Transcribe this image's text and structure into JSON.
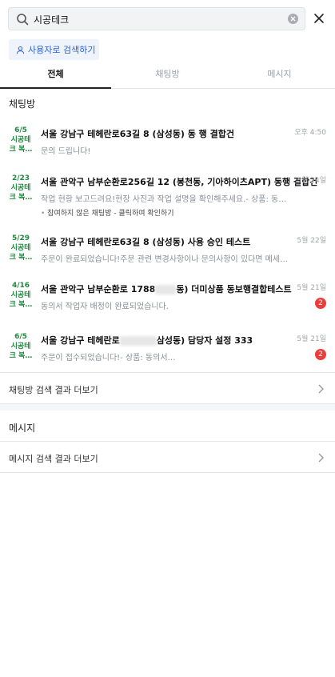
{
  "search": {
    "value": "시공테크"
  },
  "user_search_button": {
    "label": "사용자로 검색하기"
  },
  "tabs": [
    {
      "label": "전체",
      "active": true
    },
    {
      "label": "채팅방",
      "active": false
    },
    {
      "label": "메시지",
      "active": false
    }
  ],
  "chat_section": {
    "title": "채팅방",
    "items": [
      {
        "date": "6/5",
        "tag1": "시공테",
        "tag2": "크 복…",
        "title": "서울 강남구 테헤란로63길 8 (삼성동) 동 행 결합건",
        "sub": "문의 드립니다!",
        "time": "오후 4:50",
        "unread": null,
        "note": null
      },
      {
        "date": "2/23",
        "tag1": "시공테",
        "tag2": "크 복…",
        "title": "서울 관악구 남부순환로256길 12 (봉천동, 기아하이츠APT) 동행 결합건",
        "sub": "작업 현황 보고드려요!현장 사진과 작업 설명을 확인해주세요.- 상품: 동의서…",
        "time": "5월 24일",
        "unread": null,
        "note": "참여하지 않은 채팅방 - 클릭하여 확인하기"
      },
      {
        "date": "5/29",
        "tag1": "시공테",
        "tag2": "크 복…",
        "title": "서울 강남구 테헤란로63길 8 (삼성동) 사용 승인 테스트",
        "sub": "주문이 완료되었습니다!주문 관련 변경사항이나 문의사항이 있다면 메세지를 남겨주세…",
        "time": "5월 22일",
        "unread": null,
        "note": null
      },
      {
        "date": "4/16",
        "tag1": "시공테",
        "tag2": "크 복…",
        "title": "서울 관악구 남부순환로 1788",
        "title_tail": "동) 더미상품 동보행결합테스트",
        "sub": "동의서 작업자 배정이 완료되었습니다.",
        "time": "5월 21일",
        "unread": "2",
        "note": null
      },
      {
        "date": "6/5",
        "tag1": "시공테",
        "tag2": "크 복…",
        "title": "서울 강남구 테헤란로",
        "title_tail": "삼성동) 담당자 설정 333",
        "sub": "주문이 접수되었습니다!- 상품: 동의서…",
        "time": "5월 21일",
        "unread": "2",
        "note": null
      }
    ],
    "more_label": "채팅방 검색 결과 더보기"
  },
  "message_section": {
    "title": "메시지",
    "more_label": "메시지 검색 결과 더보기"
  },
  "colors": {
    "accent": "#2b62d6",
    "badge_green": "#1e8a3c",
    "unread_red": "#ee3b3b"
  }
}
